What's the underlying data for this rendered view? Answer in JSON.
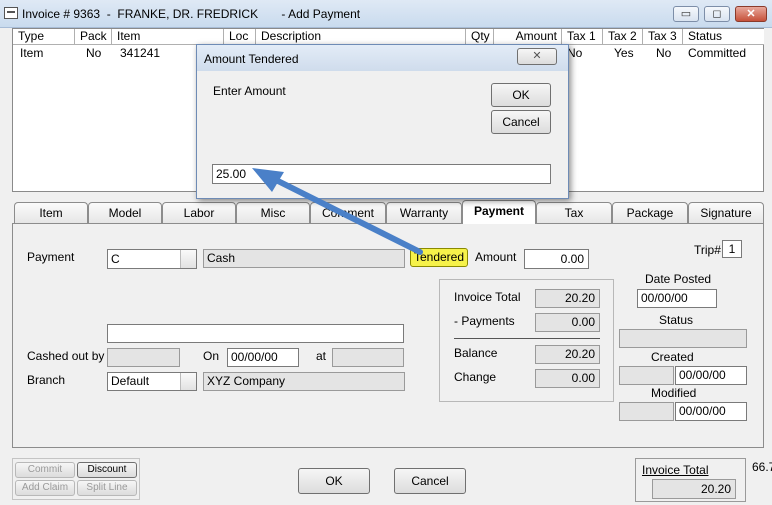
{
  "window": {
    "title": "Invoice # 9363  -  FRANKE, DR. FREDRICK       - Add Payment",
    "minimize_glyph": "▭",
    "maximize_glyph": "◻",
    "close_glyph": "✕"
  },
  "grid": {
    "columns": [
      "Type",
      "Pack",
      "Item",
      "Loc",
      "Description",
      "Qty",
      "Amount",
      "Tax 1",
      "Tax 2",
      "Tax 3",
      "Status"
    ],
    "rows": [
      {
        "type": "Item",
        "pack": "No",
        "item": "341241",
        "tax1": "No",
        "tax2": "Yes",
        "tax3": "No",
        "status": "Committed"
      }
    ]
  },
  "tabs": [
    "Item",
    "Model",
    "Labor",
    "Misc",
    "Comment",
    "Warranty",
    "Payment",
    "Tax",
    "Package",
    "Signature"
  ],
  "active_tab": "Payment",
  "payment": {
    "payment_label": "Payment",
    "payment_code": "C",
    "payment_desc": "Cash",
    "tendered_button": "Tendered",
    "amount_label": "Amount",
    "amount_value": "0.00",
    "trip_label": "Trip#",
    "trip_value": "1",
    "blank_field": "",
    "cashed_out_by_label": "Cashed out by",
    "cashed_out_by_value": "",
    "on_label": "On",
    "on_value": "00/00/00",
    "at_label": "at",
    "at_value": "",
    "branch_label": "Branch",
    "branch_value": "Default",
    "company_value": "XYZ Company"
  },
  "totals": {
    "invoice_total_label": "Invoice Total",
    "invoice_total_value": "20.20",
    "payments_label": "- Payments",
    "payments_value": "0.00",
    "balance_label": "Balance",
    "balance_value": "20.20",
    "change_label": "Change",
    "change_value": "0.00"
  },
  "right_panel": {
    "date_posted_label": "Date Posted",
    "date_posted_value": "00/00/00",
    "status_label": "Status",
    "status_value": "",
    "created_label": "Created",
    "created_value": "00/00/00",
    "created_by": "",
    "modified_label": "Modified",
    "modified_value": "00/00/00",
    "modified_by": ""
  },
  "bottom": {
    "commit": "Commit",
    "discount": "Discount",
    "add_claim": "Add Claim",
    "split_line": "Split Line",
    "ok": "OK",
    "cancel": "Cancel",
    "invoice_total_label": "Invoice Total",
    "invoice_total_side": "66.7",
    "invoice_total_value": "20.20"
  },
  "dialog": {
    "title": "Amount Tendered",
    "prompt": "Enter Amount",
    "ok": "OK",
    "cancel": "Cancel",
    "value": "25.00",
    "close_glyph": "✕"
  },
  "colors": {
    "highlight": "#f6f24a",
    "arrow": "#4a80c8"
  }
}
